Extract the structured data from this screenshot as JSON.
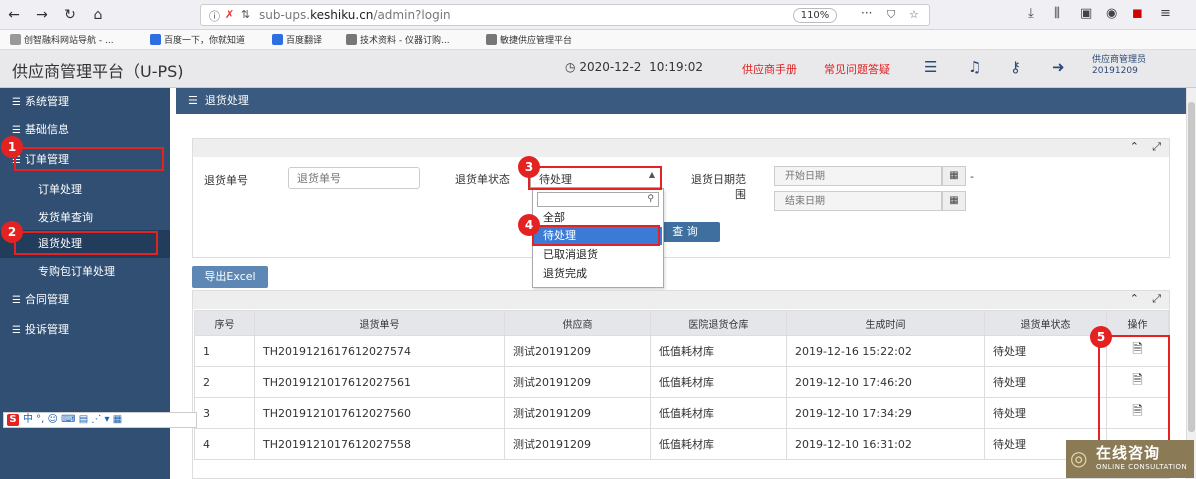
{
  "browser": {
    "url_prefix": "sub-ups.",
    "url_domain": "keshiku.cn",
    "url_path": "/admin?login",
    "zoom": "110%",
    "more_glyph": "···",
    "bookmarks": [
      "创智融科网站导航 - ...",
      "百度一下，你就知道",
      "百度翻译",
      "技术资料 - 仪器订购...",
      "敏捷供应管理平台"
    ]
  },
  "header": {
    "title": "供应商管理平台（U-PS)",
    "date": "2020-12-2",
    "time": "10:19:02",
    "manual_link": "供应商手册",
    "faq_link": "常见问题答疑",
    "user_role": "供应商管理员",
    "user_id": "20191209"
  },
  "sidebar": {
    "items": [
      {
        "label": "系统管理"
      },
      {
        "label": "基础信息"
      },
      {
        "label": "订单管理"
      },
      {
        "label": "订单处理"
      },
      {
        "label": "发货单查询"
      },
      {
        "label": "退货处理"
      },
      {
        "label": "专购包订单处理"
      },
      {
        "label": "合同管理"
      },
      {
        "label": "投诉管理"
      }
    ]
  },
  "page": {
    "heading": "退货处理",
    "return_no_label": "退货单号",
    "return_no_placeholder": "退货单号",
    "status_label": "退货单状态",
    "status_value": "待处理",
    "date_label": "退货日期范围",
    "start_placeholder": "开始日期",
    "end_placeholder": "结束日期",
    "date_sep": "-",
    "query_btn": "查 询",
    "export_btn": "导出Excel",
    "status_options": [
      "全部",
      "待处理",
      "已取消退货",
      "退货完成"
    ]
  },
  "table": {
    "headers": [
      "序号",
      "退货单号",
      "供应商",
      "医院退货仓库",
      "生成时间",
      "退货单状态",
      "操作"
    ],
    "rows": [
      [
        "1",
        "TH2019121617612027574",
        "测试20191209",
        "低值耗材库",
        "2019-12-16 15:22:02",
        "待处理"
      ],
      [
        "2",
        "TH2019121017612027561",
        "测试20191209",
        "低值耗材库",
        "2019-12-10 17:46:20",
        "待处理"
      ],
      [
        "3",
        "TH2019121017612027560",
        "测试20191209",
        "低值耗材库",
        "2019-12-10 17:34:29",
        "待处理"
      ],
      [
        "4",
        "TH2019121017612027558",
        "测试20191209",
        "低值耗材库",
        "2019-12-10 16:31:02",
        "待处理"
      ]
    ]
  },
  "annotations": [
    "1",
    "2",
    "3",
    "4",
    "5"
  ],
  "ime": {
    "logo": "S",
    "text": "中 °, ☺ ⌨ ▤ ⋰ ▾ ▦"
  },
  "online_badge": {
    "cn": "在线咨询",
    "en": "ONLINE CONSULTATION"
  },
  "colors": {
    "sidebar": "#304f73",
    "accent": "#3a5a80",
    "annotation": "#e52222",
    "highlight": "#3b7bd6",
    "header_link": "#e02020"
  }
}
